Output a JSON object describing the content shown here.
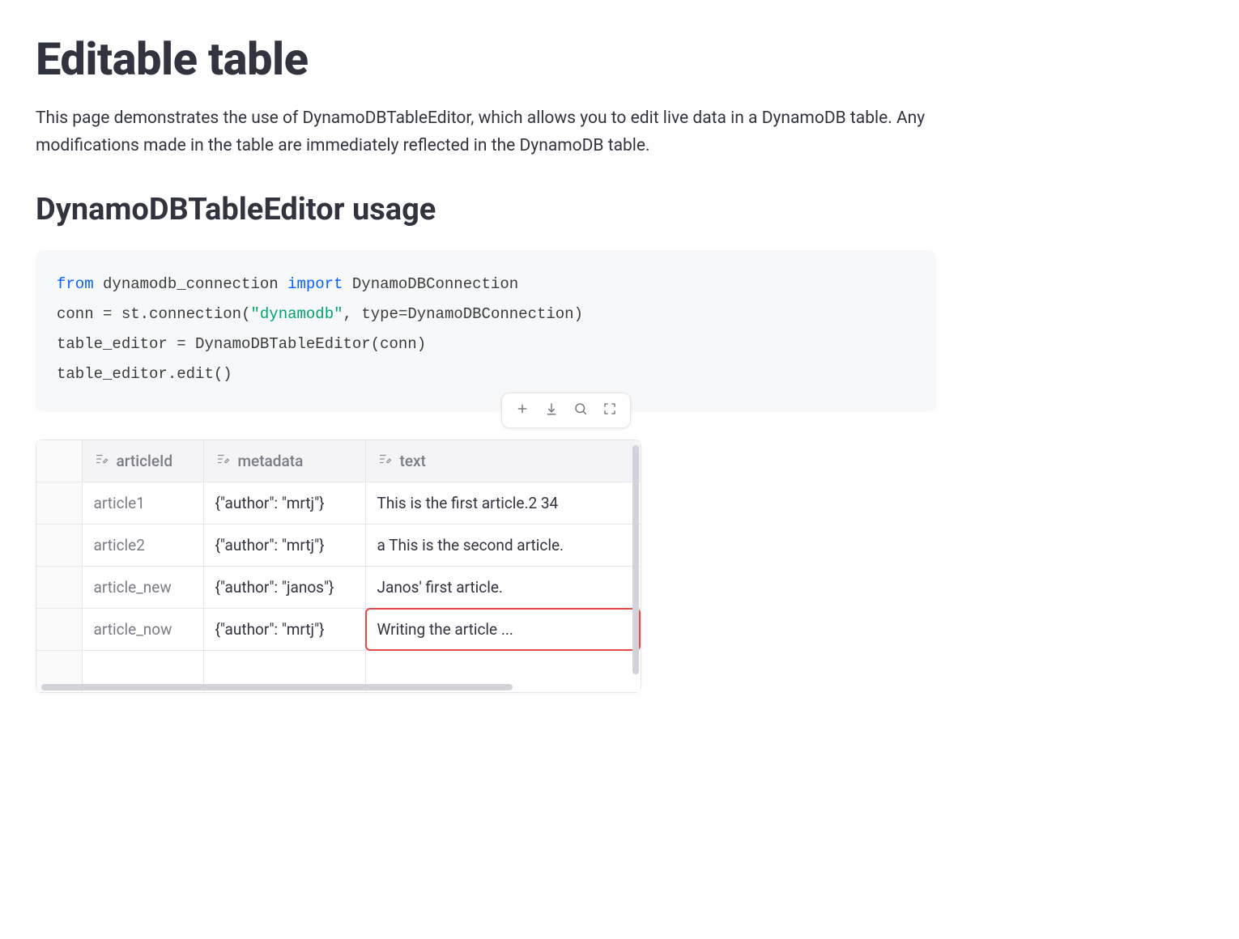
{
  "header": {
    "title": "Editable table",
    "intro": "This page demonstrates the use of DynamoDBTableEditor, which allows you to edit live data in a DynamoDB table. Any modifications made in the table are immediately reflected in the DynamoDB table."
  },
  "section": {
    "subtitle": "DynamoDBTableEditor usage"
  },
  "code": {
    "l1": {
      "kw_from": "from",
      "mod": " dynamodb_connection ",
      "kw_import": "import",
      "cls": " DynamoDBConnection"
    },
    "l2": {
      "a": "conn ",
      "eq": "=",
      "b": " st",
      "dot1": ".",
      "c": "connection",
      "lp": "(",
      "str": "\"dynamodb\"",
      "comma": ",",
      "d": " type",
      "eq2": "=",
      "e": "DynamoDBConnection",
      "rp": ")"
    },
    "l3": {
      "a": "table_editor ",
      "eq": "=",
      "b": " DynamoDBTableEditor",
      "lp": "(",
      "c": "conn",
      "rp": ")"
    },
    "l4": {
      "a": "table_editor",
      "dot": ".",
      "b": "edit",
      "lp": "(",
      "rp": ")"
    }
  },
  "toolbar": {
    "add_hint": "Add row",
    "download_hint": "Download",
    "search_hint": "Search",
    "fullscreen_hint": "Fullscreen"
  },
  "table": {
    "columns": {
      "articleId": "articleId",
      "metadata": "metadata",
      "text": "text"
    },
    "rows": [
      {
        "articleId": "article1",
        "metadata": "{\"author\": \"mrtj\"}",
        "text": "This is the first article.2 34"
      },
      {
        "articleId": "article2",
        "metadata": "{\"author\": \"mrtj\"}",
        "text": "a This is the second article."
      },
      {
        "articleId": "article_new",
        "metadata": "{\"author\": \"janos\"}",
        "text": "Janos' first article."
      },
      {
        "articleId": "article_now",
        "metadata": "{\"author\": \"mrtj\"}",
        "text": "Writing the article ..."
      }
    ],
    "editing_row_index": 3,
    "editing_col": "text"
  }
}
